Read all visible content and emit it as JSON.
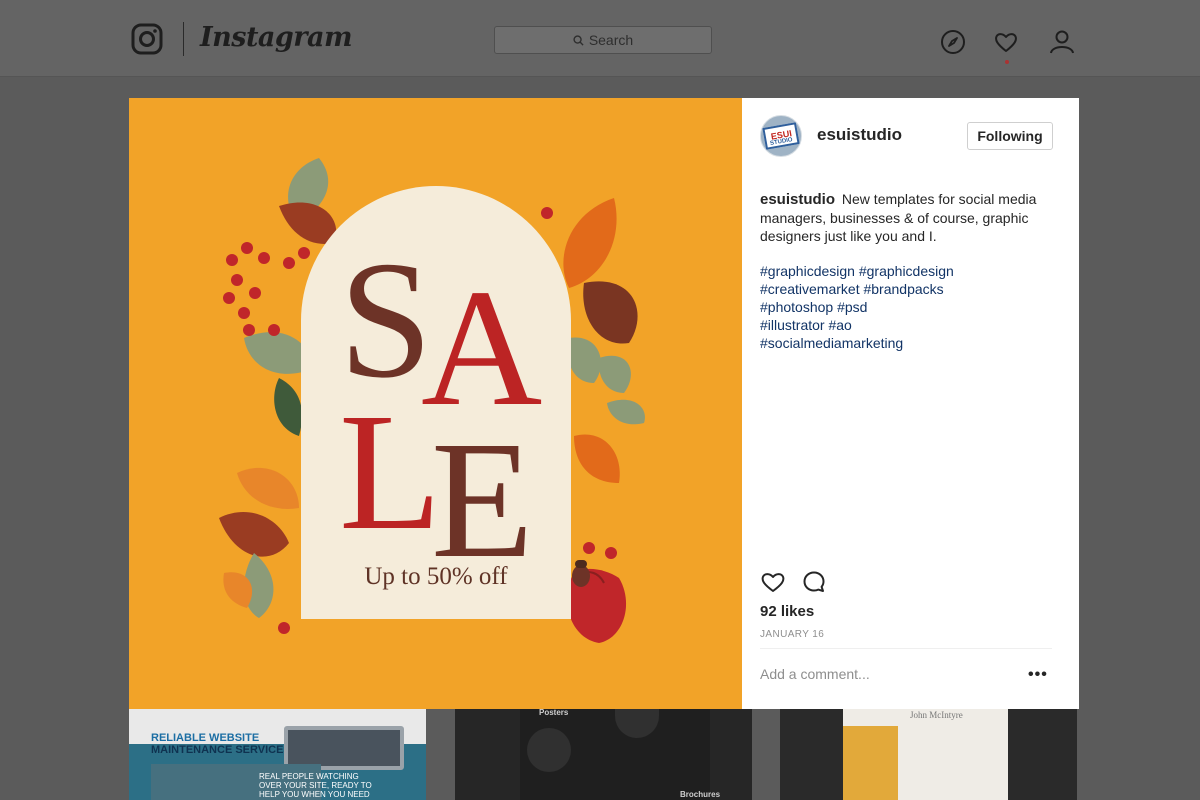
{
  "nav": {
    "brand": "Instagram",
    "search_placeholder": "Search"
  },
  "post": {
    "headline_letters": [
      "S",
      "A",
      "L",
      "E"
    ],
    "subline": "Up to 50% off"
  },
  "sidebar": {
    "username": "esuistudio",
    "follow_label": "Following",
    "avatar_text_top": "ESUI",
    "avatar_text_bottom": "STUDIO",
    "caption_user": "esuistudio",
    "caption_text": "New templates for social media managers, businesses & of course, graphic designers just like you and I.",
    "hashtag_lines": [
      "#graphicdesign #graphicdesign",
      "#creativemarket #brandpacks",
      "#photoshop #psd",
      "#illustrator #ao",
      "#socialmediamarketing"
    ],
    "likes": "92 likes",
    "date": "JANUARY 16",
    "comment_placeholder": "Add a comment...",
    "more_label": "•••"
  },
  "grid": {
    "thumb1_title_a": "RELIABLE WEBSITE",
    "thumb1_title_b": "MAINTENANCE SERVICES",
    "thumb1_text": "REAL PEOPLE WATCHING OVER YOUR SITE, READY TO HELP YOU WHEN YOU NEED IT",
    "thumb2_label": "Posters",
    "thumb2_label2": "Brochures",
    "thumb3_name": "John McIntyre"
  },
  "colors": {
    "post_background": "#f2a328",
    "arch": "#f5ecda",
    "letter_red": "#bc2424",
    "letter_brown": "#6d3327",
    "hashtag": "#123466"
  }
}
